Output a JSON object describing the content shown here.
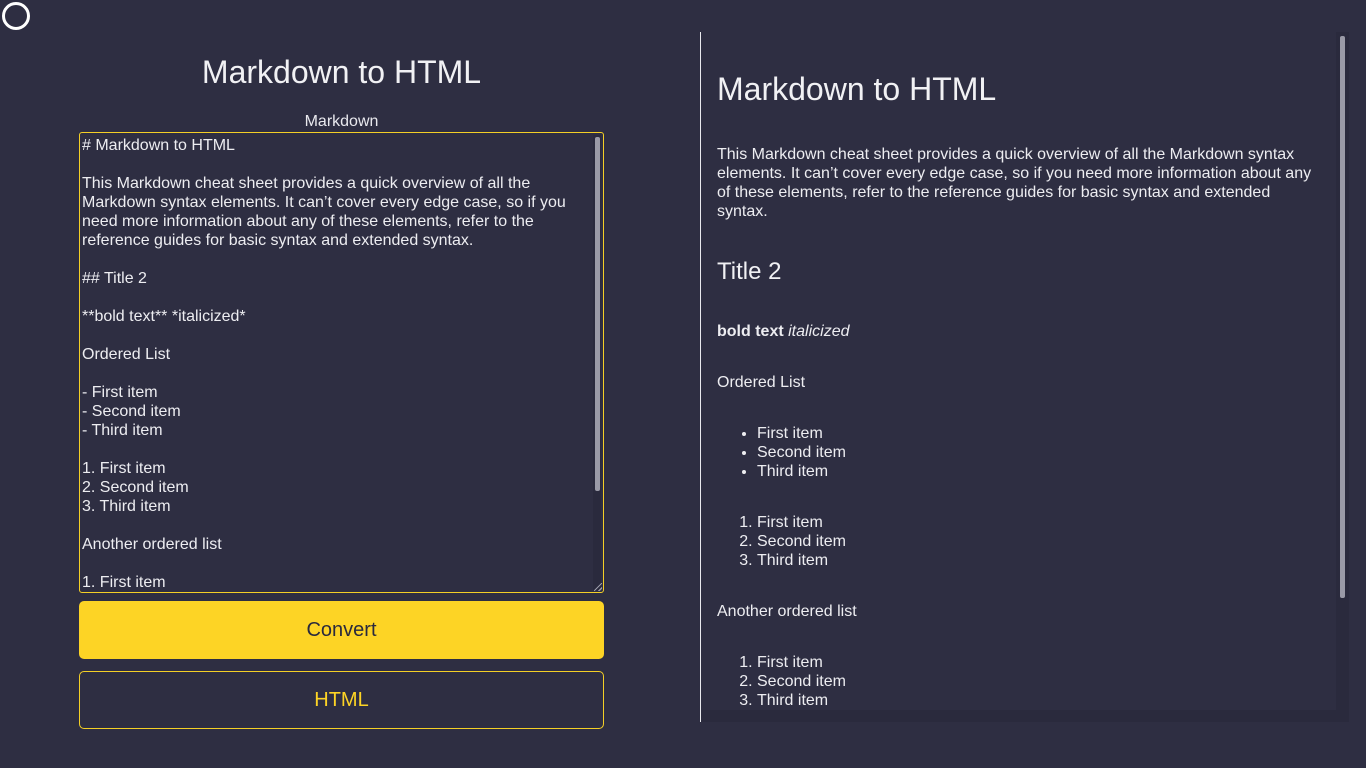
{
  "app": {
    "title": "Markdown to HTML"
  },
  "editor": {
    "label": "Markdown",
    "value": "# Markdown to HTML\n\nThis Markdown cheat sheet provides a quick overview of all the Markdown syntax elements. It can’t cover every edge case, so if you need more information about any of these elements, refer to the reference guides for basic syntax and extended syntax.\n\n## Title 2\n\n**bold text** *italicized*\n\nOrdered List\n\n- First item\n- Second item\n- Third item\n\n1. First item\n2. Second item\n3. Third item\n\nAnother ordered list\n\n1. First item"
  },
  "buttons": {
    "convert_label": "Convert",
    "html_label": "HTML"
  },
  "preview": {
    "h1": "Markdown to HTML",
    "intro": "This Markdown cheat sheet provides a quick overview of all the Markdown syntax elements. It can’t cover every edge case, so if you need more information about any of these elements, refer to the reference guides for basic syntax and extended syntax.",
    "h2": "Title 2",
    "bold_text": "bold text",
    "italic_text": "italicized",
    "ordered_list_label": "Ordered List",
    "bullet_items": [
      "First item",
      "Second item",
      "Third item"
    ],
    "ordered_items_1": [
      "First item",
      "Second item",
      "Third item"
    ],
    "another_list_label": "Another ordered list",
    "ordered_items_2": [
      "First item",
      "Second item",
      "Third item"
    ]
  },
  "colors": {
    "background": "#2e2e42",
    "accent": "#fdd425",
    "text": "#ededf1"
  },
  "icons": {
    "top_left": "circle-icon"
  }
}
